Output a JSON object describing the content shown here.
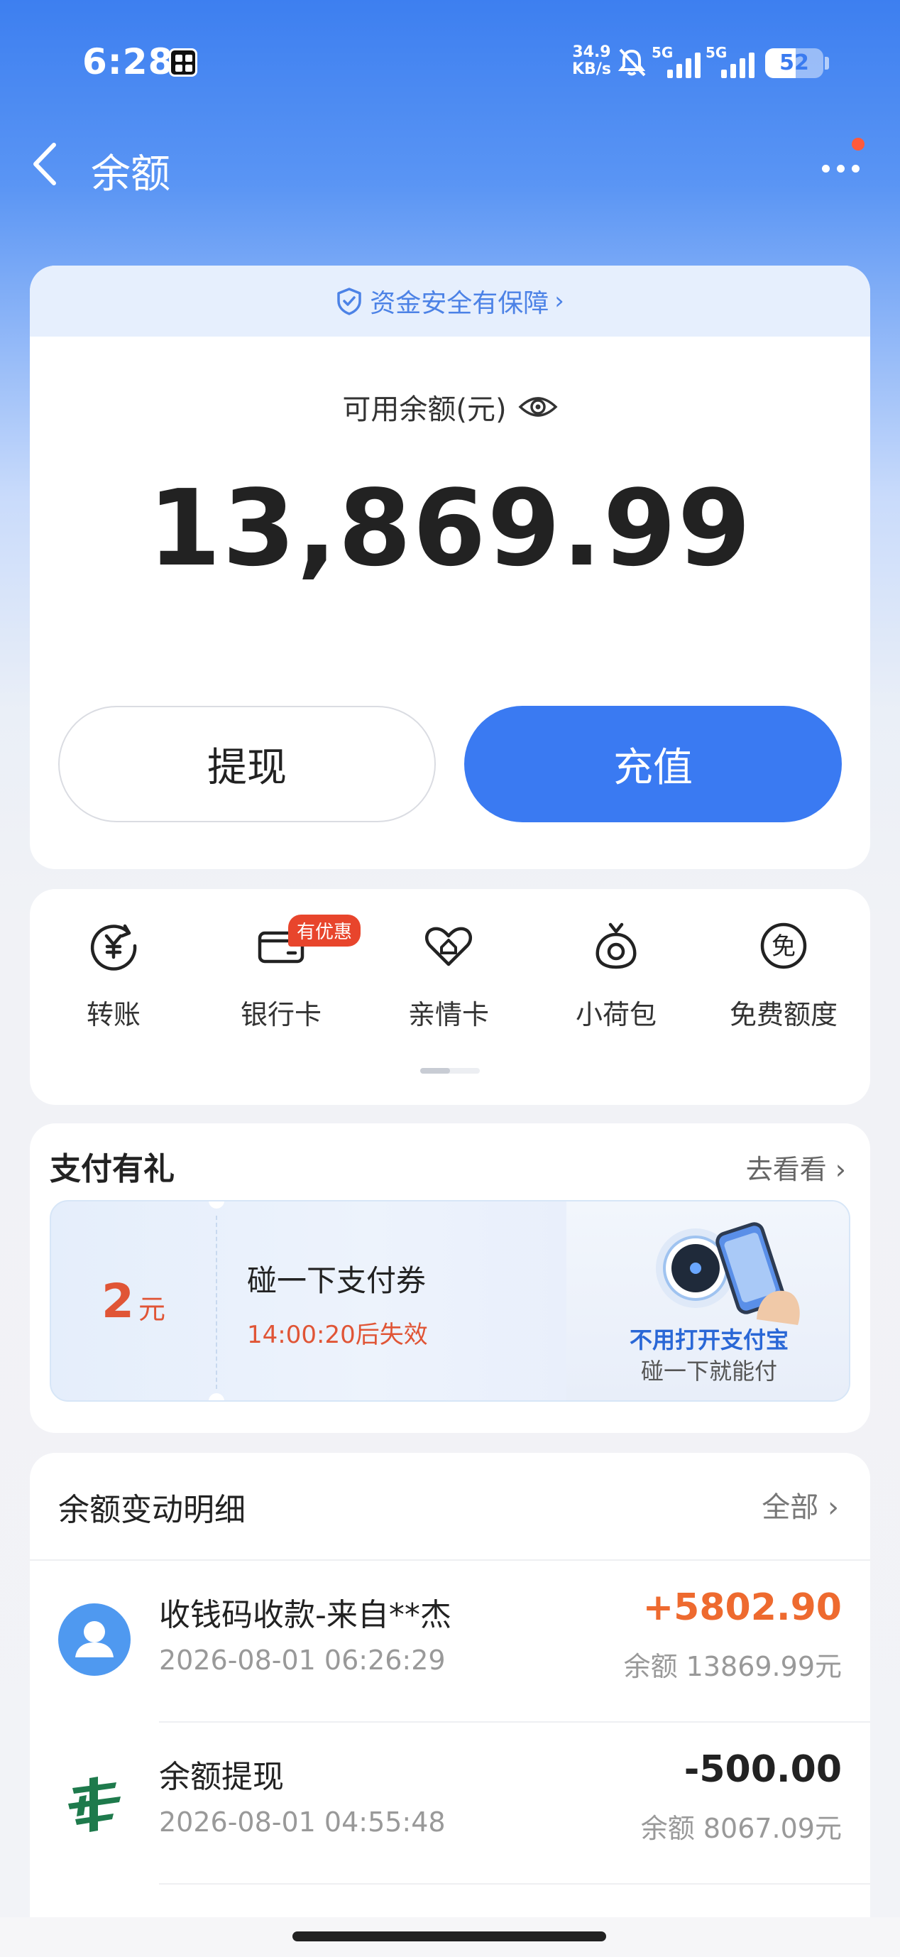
{
  "status_bar": {
    "time": "6:28",
    "speed_value": "34.9",
    "speed_unit": "KB/s",
    "network_1": "5G",
    "network_2": "5G",
    "battery": "52",
    "battery_level": 0.52
  },
  "nav": {
    "title": "余额"
  },
  "balance_card": {
    "safety_text": "资金安全有保障",
    "label": "可用余额(元)",
    "amount": "13,869.99",
    "withdraw_label": "提现",
    "recharge_label": "充值"
  },
  "shortcuts": [
    {
      "label": "转账",
      "icon": "transfer-yen-icon"
    },
    {
      "label": "银行卡",
      "icon": "bank-card-icon",
      "tag": "有优惠"
    },
    {
      "label": "亲情卡",
      "icon": "family-card-icon"
    },
    {
      "label": "小荷包",
      "icon": "small-pouch-icon"
    },
    {
      "label": "免费额度",
      "icon": "free-quota-icon"
    }
  ],
  "promo": {
    "title": "支付有礼",
    "more_label": "去看看",
    "coupon": {
      "value": "2",
      "unit": "元",
      "name": "碰一下支付券",
      "expire": "14:00:20后失效",
      "ad_headline": "不用打开支付宝",
      "ad_subline": "碰一下就能付"
    }
  },
  "details": {
    "title": "余额变动明细",
    "all_label": "全部",
    "transactions": [
      {
        "name": "收钱码收款-来自**杰",
        "time": "2026-08-01 06:26:29",
        "amount": "+5802.90",
        "balance": "余额 13869.99元",
        "icon": "user-avatar-icon"
      },
      {
        "name": "余额提现",
        "time": "2026-08-01 04:55:48",
        "amount": "-500.00",
        "balance": "余额 8067.09元",
        "icon": "postal-bank-icon"
      }
    ]
  },
  "colors": {
    "primary": "#3a7af2",
    "income": "#ee6a2f",
    "expire": "#e05536"
  }
}
